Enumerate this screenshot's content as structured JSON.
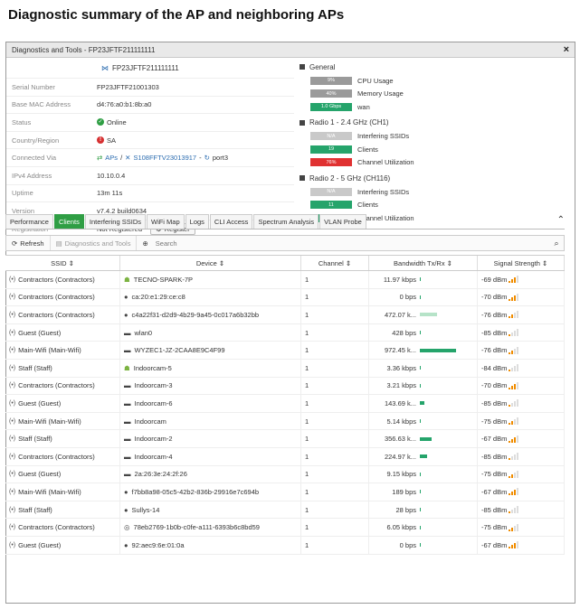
{
  "page_title": "Diagnostic summary of the AP and neighboring APs",
  "window": {
    "title": "Diagnostics and Tools - FP23JFTF211111111",
    "close_label": "×"
  },
  "ap": {
    "name": "FP23JFTF211111111",
    "fields": [
      {
        "label": "Serial Number",
        "value": "FP23JFTF21001303"
      },
      {
        "label": "Base MAC Address",
        "value": "d4:76:a0:b1:8b:a0"
      },
      {
        "label": "Status",
        "value": "Online"
      },
      {
        "label": "Country/Region",
        "value": "SA"
      },
      {
        "label": "Connected Via",
        "value_parts": [
          "APs",
          "S108FFTV23013917",
          "port3"
        ]
      },
      {
        "label": "IPv4 Address",
        "value": "10.10.0.4"
      },
      {
        "label": "Uptime",
        "value": "13m 11s"
      },
      {
        "label": "Version",
        "value": "v7.4.2 build0634"
      },
      {
        "label": "Registration",
        "value": "Not Registered",
        "button": "Register"
      }
    ]
  },
  "general": {
    "title": "General",
    "metrics": [
      {
        "bar": "9%",
        "label": "CPU Usage",
        "color": "#9a9a9a"
      },
      {
        "bar": "40%",
        "label": "Memory Usage",
        "color": "#9a9a9a"
      },
      {
        "bar": "1.0 Gbps",
        "label": "wan",
        "color": "#25a46b"
      }
    ]
  },
  "radio1": {
    "title": "Radio 1 - 2.4 GHz (CH1)",
    "metrics": [
      {
        "bar": "N/A",
        "label": "Interfering SSIDs",
        "color": "#c9c9c9"
      },
      {
        "bar": "19",
        "label": "Clients",
        "color": "#25a46b"
      },
      {
        "bar": "76%",
        "label": "Channel Utilization",
        "color": "#e03131"
      }
    ]
  },
  "radio2": {
    "title": "Radio 2 - 5 GHz (CH116)",
    "metrics": [
      {
        "bar": "N/A",
        "label": "Interfering SSIDs",
        "color": "#c9c9c9"
      },
      {
        "bar": "11",
        "label": "Clients",
        "color": "#25a46b"
      },
      {
        "bar": "0%",
        "label": "Channel Utilization",
        "color": "#25a46b"
      }
    ]
  },
  "tabs": [
    "Performance",
    "Clients",
    "Interfering SSIDs",
    "WiFi Map",
    "Logs",
    "CLI Access",
    "Spectrum Analysis",
    "VLAN Probe"
  ],
  "active_tab": "Clients",
  "toolbar": {
    "refresh": "Refresh",
    "diag": "Diagnostics and Tools",
    "search_placeholder": "Search"
  },
  "table": {
    "headers": [
      "SSID ⇕",
      "Device ⇕",
      "Channel ⇕",
      "Bandwidth Tx/Rx ⇕",
      "Signal Strength ⇕"
    ],
    "rows": [
      {
        "ssid": "Contractors (Contractors)",
        "device": "TECNO-SPARK-7P",
        "icon": "android",
        "channel": "1",
        "bw": "11.97 kbps",
        "bw_frac": 0.01,
        "bw_light": false,
        "signal": "-69 dBm",
        "bars": 3
      },
      {
        "ssid": "Contractors (Contractors)",
        "device": "ca:20:e1:29:ce:c8",
        "icon": "apple",
        "channel": "1",
        "bw": "0 bps",
        "bw_frac": 0,
        "bw_light": false,
        "signal": "-70 dBm",
        "bars": 3
      },
      {
        "ssid": "Contractors (Contractors)",
        "device": "c4a22f31-d2d9-4b29-9a45-0c017a6b32bb",
        "icon": "apple",
        "channel": "1",
        "bw": "472.07 k...",
        "bw_frac": 0.3,
        "bw_light": true,
        "signal": "-76 dBm",
        "bars": 2
      },
      {
        "ssid": "Guest (Guest)",
        "device": "wlan0",
        "icon": "monitor",
        "channel": "1",
        "bw": "428 bps",
        "bw_frac": 0.01,
        "bw_light": false,
        "signal": "-85 dBm",
        "bars": 1
      },
      {
        "ssid": "Main-Wifi (Main-Wifi)",
        "device": "WYZEC1-JZ-2CAA8E9C4F99",
        "icon": "monitor",
        "channel": "1",
        "bw": "972.45 k...",
        "bw_frac": 0.62,
        "bw_light": false,
        "signal": "-76 dBm",
        "bars": 2
      },
      {
        "ssid": "Staff (Staff)",
        "device": "Indoorcam-5",
        "icon": "android",
        "channel": "1",
        "bw": "3.36 kbps",
        "bw_frac": 0.01,
        "bw_light": false,
        "signal": "-84 dBm",
        "bars": 1
      },
      {
        "ssid": "Contractors (Contractors)",
        "device": "Indoorcam-3",
        "icon": "monitor",
        "channel": "1",
        "bw": "3.21 kbps",
        "bw_frac": 0.01,
        "bw_light": false,
        "signal": "-70 dBm",
        "bars": 3
      },
      {
        "ssid": "Guest (Guest)",
        "device": "Indoorcam-6",
        "icon": "monitor",
        "channel": "1",
        "bw": "143.69 k...",
        "bw_frac": 0.08,
        "bw_light": false,
        "signal": "-85 dBm",
        "bars": 1
      },
      {
        "ssid": "Main-Wifi (Main-Wifi)",
        "device": "Indoorcam",
        "icon": "monitor",
        "channel": "1",
        "bw": "5.14 kbps",
        "bw_frac": 0.01,
        "bw_light": false,
        "signal": "-75 dBm",
        "bars": 2
      },
      {
        "ssid": "Staff (Staff)",
        "device": "Indoorcam-2",
        "icon": "monitor",
        "channel": "1",
        "bw": "356.63 k...",
        "bw_frac": 0.2,
        "bw_light": false,
        "signal": "-67 dBm",
        "bars": 3
      },
      {
        "ssid": "Contractors (Contractors)",
        "device": "Indoorcam-4",
        "icon": "monitor",
        "channel": "1",
        "bw": "224.97 k...",
        "bw_frac": 0.12,
        "bw_light": false,
        "signal": "-85 dBm",
        "bars": 1
      },
      {
        "ssid": "Guest (Guest)",
        "device": "2a:26:3e:24:2f:26",
        "icon": "monitor",
        "channel": "1",
        "bw": "9.15 kbps",
        "bw_frac": 0.01,
        "bw_light": false,
        "signal": "-75 dBm",
        "bars": 2
      },
      {
        "ssid": "Main-Wifi (Main-Wifi)",
        "device": "f7bb8a98-05c5-42b2-836b-29916e7c694b",
        "icon": "apple",
        "channel": "1",
        "bw": "189 bps",
        "bw_frac": 0,
        "bw_light": false,
        "signal": "-67 dBm",
        "bars": 3
      },
      {
        "ssid": "Staff (Staff)",
        "device": "Sullys-14",
        "icon": "apple",
        "channel": "1",
        "bw": "28 bps",
        "bw_frac": 0,
        "bw_light": false,
        "signal": "-85 dBm",
        "bars": 1
      },
      {
        "ssid": "Contractors (Contractors)",
        "device": "78eb2769-1b0b-c0fe-a111-6393b6c8bd59",
        "icon": "chrome",
        "channel": "1",
        "bw": "6.05 kbps",
        "bw_frac": 0.01,
        "bw_light": false,
        "signal": "-75 dBm",
        "bars": 2
      },
      {
        "ssid": "Guest (Guest)",
        "device": "92:aec9:6e:01:0a",
        "icon": "apple",
        "channel": "1",
        "bw": "0 bps",
        "bw_frac": 0,
        "bw_light": false,
        "signal": "-67 dBm",
        "bars": 3
      }
    ]
  }
}
